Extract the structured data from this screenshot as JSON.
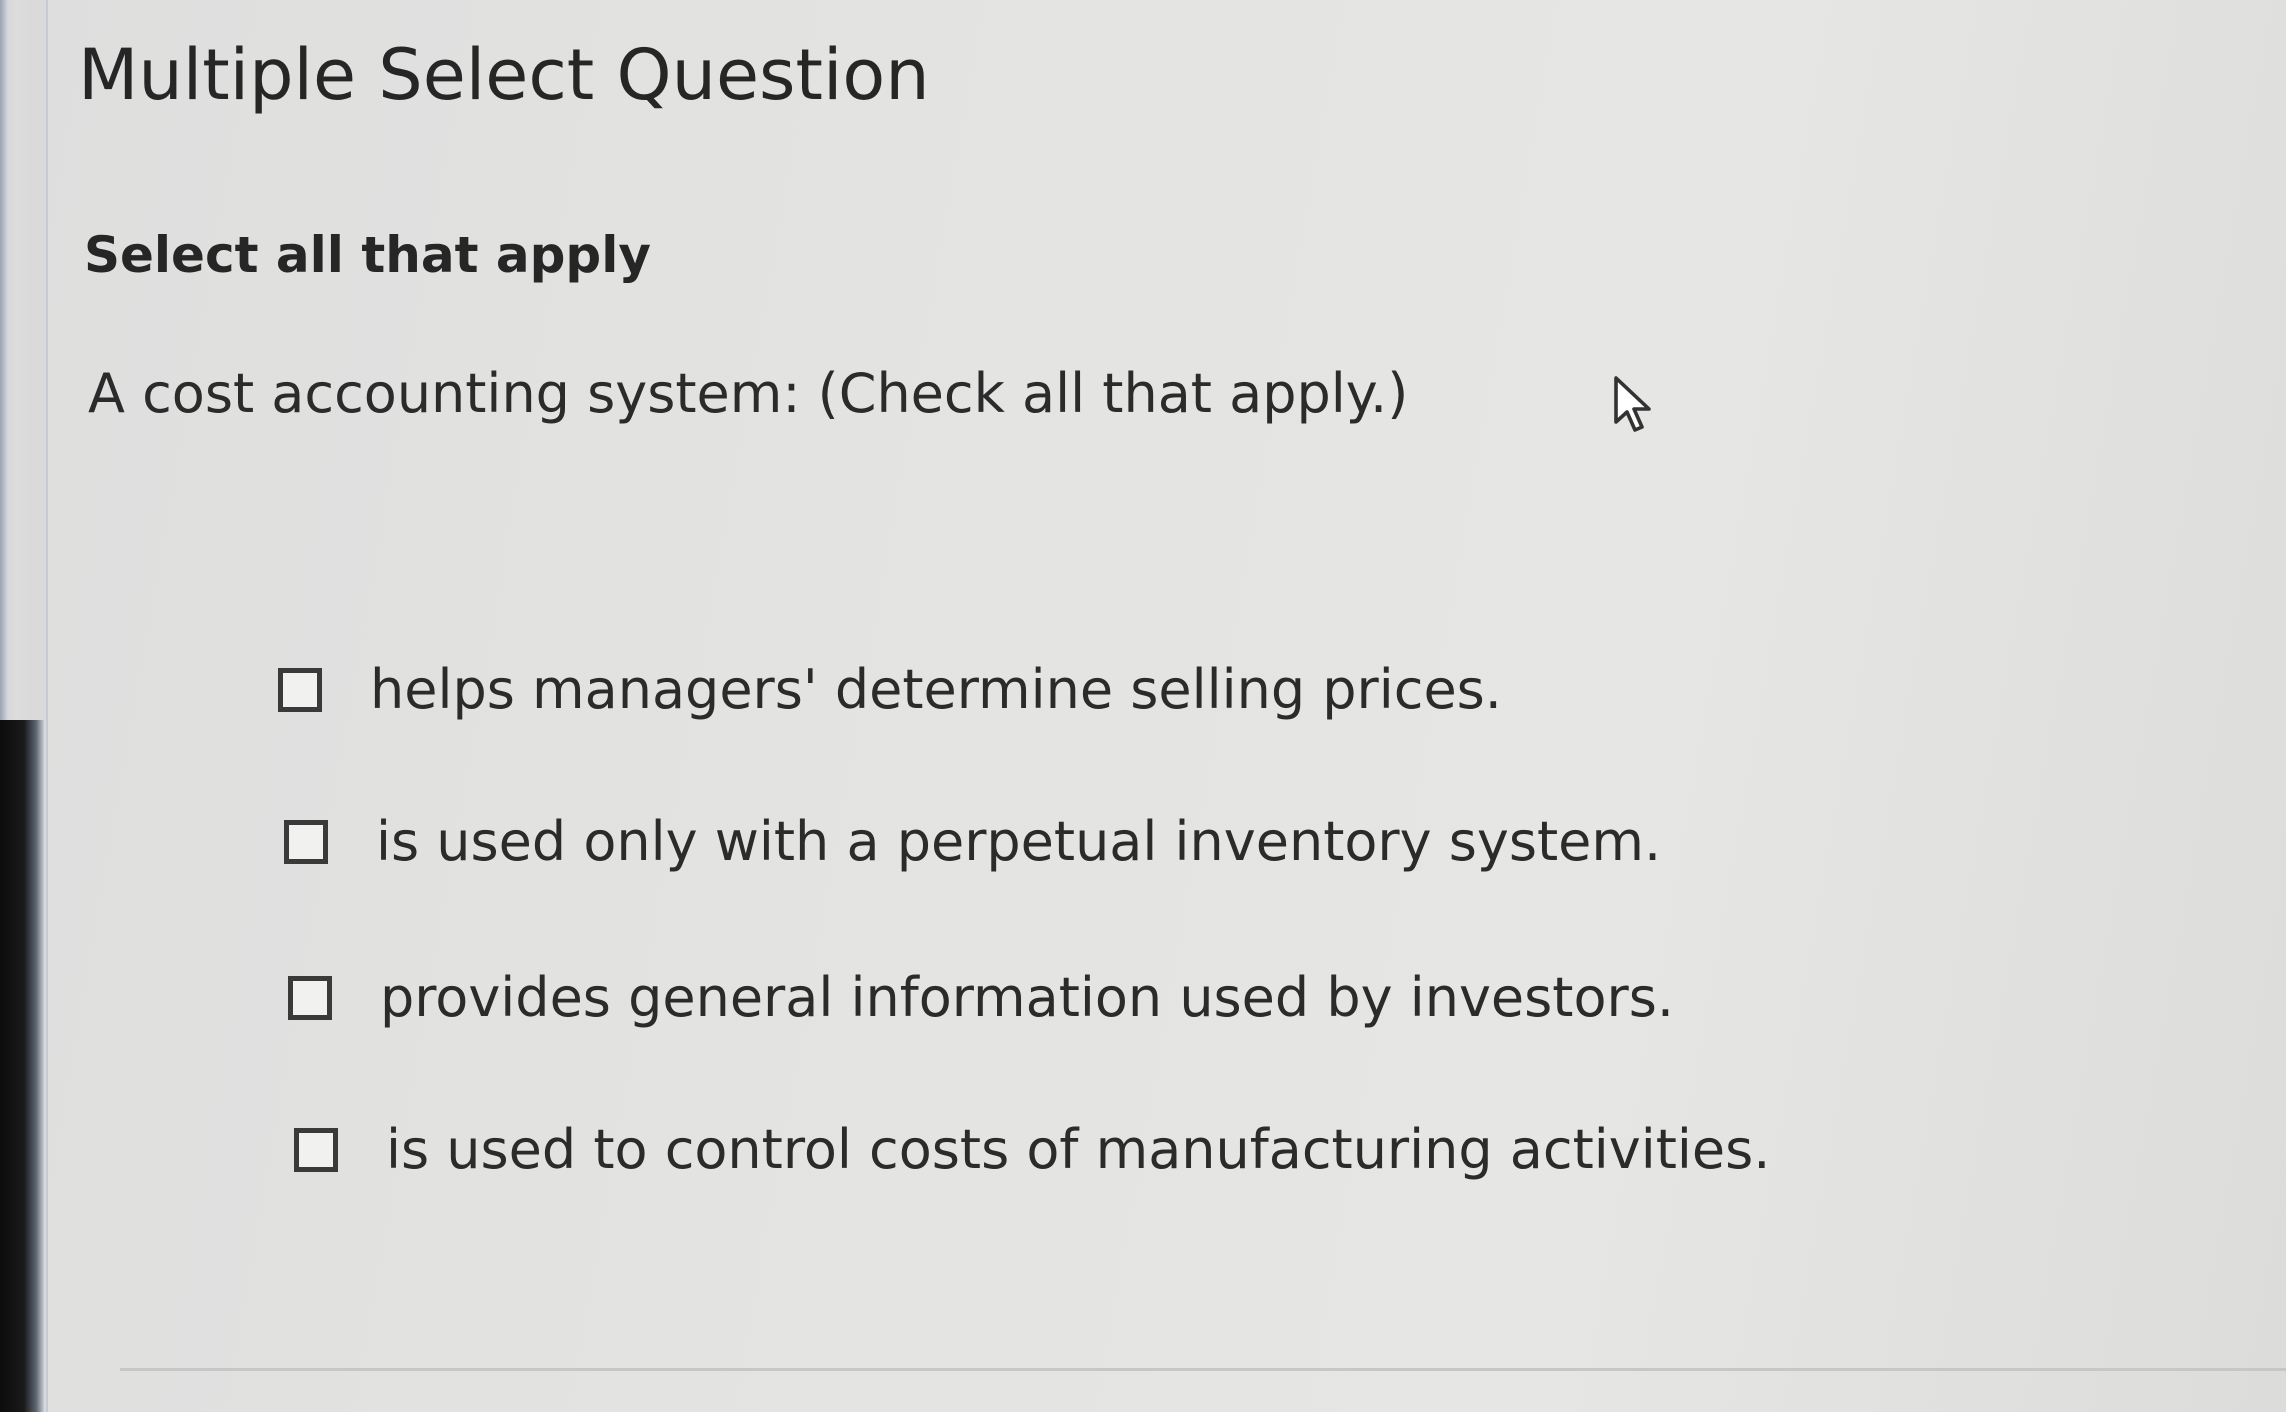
{
  "header": {
    "title": "Multiple Select Question",
    "instruction": "Select all that apply"
  },
  "question": {
    "prompt": "A cost accounting system: (Check all that apply.)"
  },
  "options": [
    {
      "label": "helps managers' determine selling prices.",
      "checked": false
    },
    {
      "label": "is used only with a perpetual inventory system.",
      "checked": false
    },
    {
      "label": "provides general information used by investors.",
      "checked": false
    },
    {
      "label": "is used to control costs of manufacturing activities.",
      "checked": false
    }
  ],
  "icons": {
    "cursor": "mouse-pointer-icon",
    "checkbox": "checkbox-icon"
  }
}
